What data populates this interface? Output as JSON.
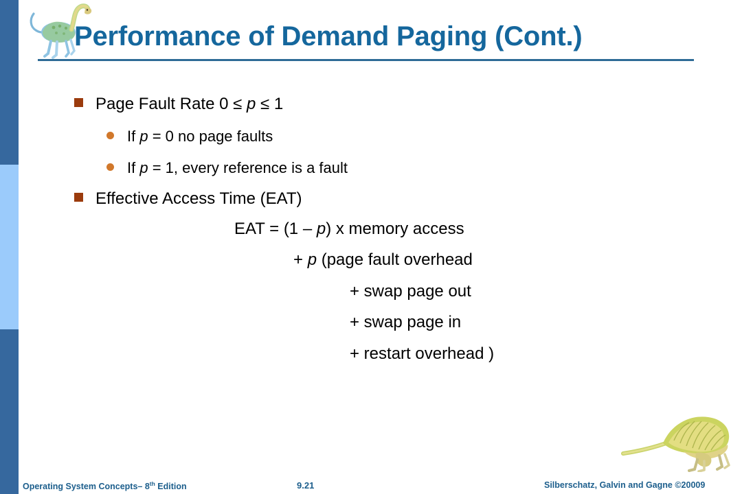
{
  "theme": {
    "title_color": "#15679D",
    "rule_color": "#2E6B96",
    "sidebar_dark": "#36689E",
    "sidebar_light": "#9BCBFB",
    "square_bullet_color": "#9B3B0D",
    "round_bullet_color": "#D1782B",
    "footer_color": "#1C5E8C",
    "background": "#FFFFFF"
  },
  "title": {
    "text": "Performance of Demand Paging (Cont.)"
  },
  "decor": {
    "top_dino_name": "long-necked-dinosaur-illustration",
    "bottom_dino_name": "sail-backed-dinosaur-illustration"
  },
  "bullets": [
    {
      "level": 1,
      "marker": "square-bullet",
      "parts": [
        {
          "t": "Page Fault Rate 0 ",
          "i": false
        },
        {
          "t": "≤ ",
          "i": false
        },
        {
          "t": "p",
          "i": true
        },
        {
          "t": " ≤ 1",
          "i": false
        }
      ]
    },
    {
      "level": 2,
      "marker": "round-bullet",
      "parts": [
        {
          "t": "If ",
          "i": false
        },
        {
          "t": "p",
          "i": true
        },
        {
          "t": " = 0 no page faults",
          "i": false
        }
      ]
    },
    {
      "level": 2,
      "marker": "round-bullet",
      "parts": [
        {
          "t": "If ",
          "i": false
        },
        {
          "t": "p",
          "i": true
        },
        {
          "t": " = 1, every reference is a fault",
          "i": false
        }
      ]
    },
    {
      "level": 1,
      "marker": "square-bullet",
      "parts": [
        {
          "t": "Effective Access Time (EAT)",
          "i": false
        }
      ]
    }
  ],
  "eat_formula": [
    {
      "name": "eat-line-1",
      "parts": [
        {
          "t": "EAT = (1 – ",
          "i": false
        },
        {
          "t": "p",
          "i": true
        },
        {
          "t": ") x memory access",
          "i": false
        }
      ]
    },
    {
      "name": "eat-line-2",
      "parts": [
        {
          "t": "+ ",
          "i": false
        },
        {
          "t": "p",
          "i": true
        },
        {
          "t": " (page fault overhead",
          "i": false
        }
      ]
    },
    {
      "name": "eat-line-3",
      "parts": [
        {
          "t": "+ swap page out",
          "i": false
        }
      ]
    },
    {
      "name": "eat-line-4",
      "parts": [
        {
          "t": "+ swap page in",
          "i": false
        }
      ]
    },
    {
      "name": "eat-line-5",
      "parts": [
        {
          "t": "+ restart overhead )",
          "i": false
        }
      ]
    }
  ],
  "footer": {
    "left_main": "Operating System Concepts– 8",
    "left_sup": "th",
    "left_tail": " Edition",
    "page_number": "9.21",
    "right": "Silberschatz, Galvin and Gagne ©20009"
  }
}
